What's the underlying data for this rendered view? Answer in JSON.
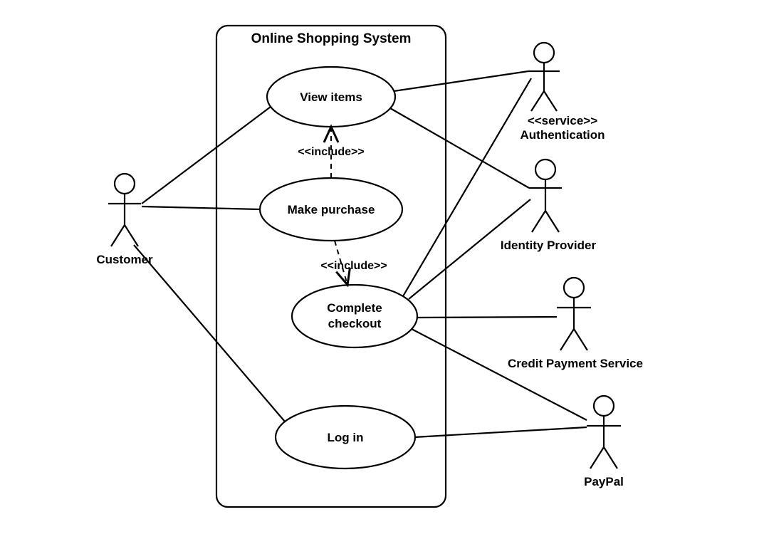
{
  "system": {
    "title": "Online Shopping System"
  },
  "actors": {
    "customer": "Customer",
    "auth": {
      "stereotype": "<<service>>",
      "name": "Authentication"
    },
    "idp": "Identity Provider",
    "credit": "Credit Payment Service",
    "paypal": "PayPal"
  },
  "usecases": {
    "view": "View items",
    "make": "Make purchase",
    "complete_line1": "Complete",
    "complete_line2": "checkout",
    "login": "Log in"
  },
  "relations": {
    "include1": "<<include>>",
    "include2": "<<include>>"
  }
}
